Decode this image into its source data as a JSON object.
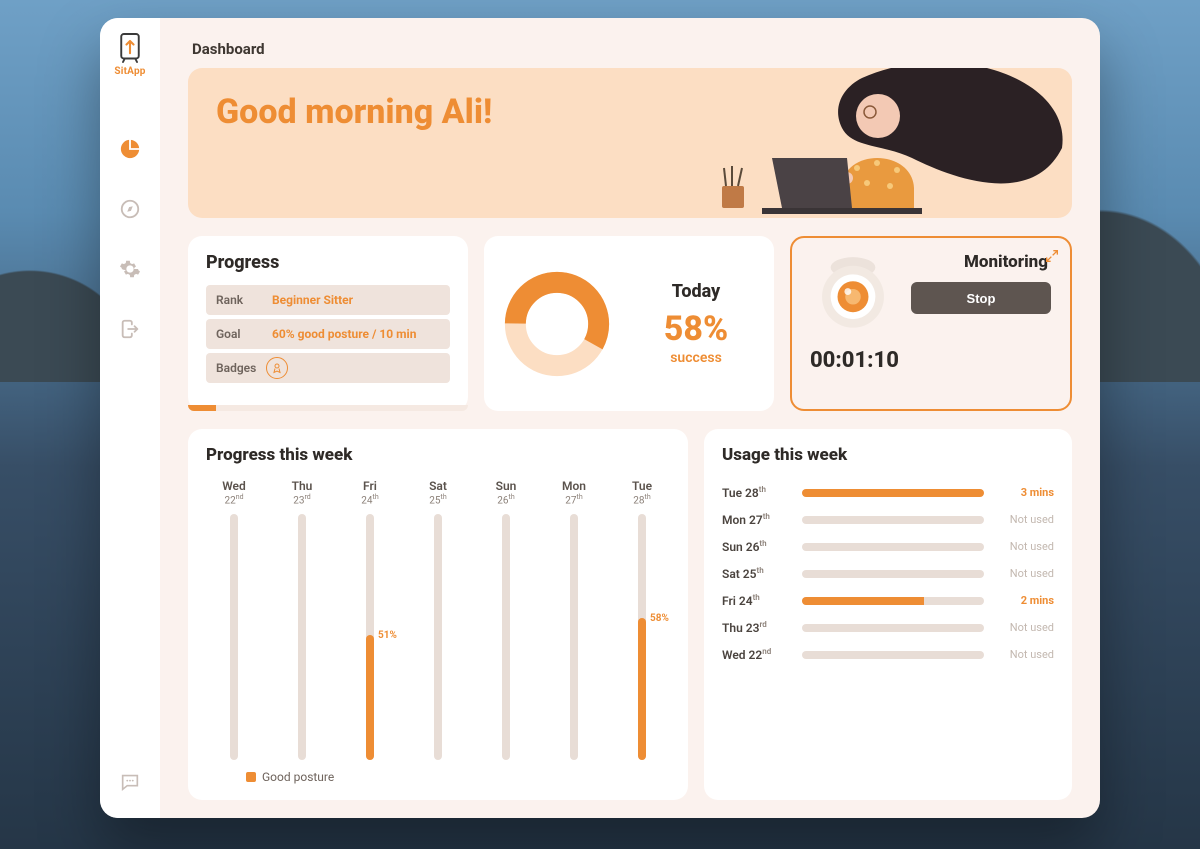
{
  "app": {
    "name": "SitApp"
  },
  "page": {
    "title": "Dashboard"
  },
  "hero": {
    "greeting": "Good morning Ali!"
  },
  "sidebar": {
    "items": [
      {
        "name": "dashboard",
        "active": true
      },
      {
        "name": "explore",
        "active": false
      },
      {
        "name": "settings",
        "active": false
      },
      {
        "name": "logout",
        "active": false
      }
    ],
    "footer_item": {
      "name": "chat"
    }
  },
  "progress_card": {
    "title": "Progress",
    "rank_label": "Rank",
    "rank_value": "Beginner Sitter",
    "goal_label": "Goal",
    "goal_value": "60% good posture / 10 min",
    "badges_label": "Badges",
    "progress_percent": 10
  },
  "today_card": {
    "title": "Today",
    "percent_text": "58%",
    "percent_value": 58,
    "subtitle": "success"
  },
  "monitoring_card": {
    "title": "Monitoring",
    "stop_label": "Stop",
    "timer": "00:01:10"
  },
  "progress_week": {
    "title": "Progress this week",
    "legend": "Good posture",
    "days": [
      {
        "name": "Wed",
        "date": "22",
        "ord": "nd",
        "value": null
      },
      {
        "name": "Thu",
        "date": "23",
        "ord": "rd",
        "value": null
      },
      {
        "name": "Fri",
        "date": "24",
        "ord": "th",
        "value": 51
      },
      {
        "name": "Sat",
        "date": "25",
        "ord": "th",
        "value": null
      },
      {
        "name": "Sun",
        "date": "26",
        "ord": "th",
        "value": null
      },
      {
        "name": "Mon",
        "date": "27",
        "ord": "th",
        "value": null
      },
      {
        "name": "Tue",
        "date": "28",
        "ord": "th",
        "value": 58
      }
    ]
  },
  "usage_week": {
    "title": "Usage this week",
    "max_minutes": 3,
    "days": [
      {
        "label": "Tue 28",
        "ord": "th",
        "minutes": 3,
        "text": "3 mins"
      },
      {
        "label": "Mon 27",
        "ord": "th",
        "minutes": 0,
        "text": "Not used"
      },
      {
        "label": "Sun 26",
        "ord": "th",
        "minutes": 0,
        "text": "Not used"
      },
      {
        "label": "Sat 25",
        "ord": "th",
        "minutes": 0,
        "text": "Not used"
      },
      {
        "label": "Fri 24",
        "ord": "th",
        "minutes": 2,
        "text": "2 mins"
      },
      {
        "label": "Thu 23",
        "ord": "rd",
        "minutes": 0,
        "text": "Not used"
      },
      {
        "label": "Wed 22",
        "ord": "nd",
        "minutes": 0,
        "text": "Not used"
      }
    ]
  },
  "chart_data": [
    {
      "type": "bar",
      "title": "Progress this week",
      "ylabel": "Good posture %",
      "ylim": [
        0,
        100
      ],
      "categories": [
        "Wed 22",
        "Thu 23",
        "Fri 24",
        "Sat 25",
        "Sun 26",
        "Mon 27",
        "Tue 28"
      ],
      "values": [
        null,
        null,
        51,
        null,
        null,
        null,
        58
      ],
      "series_name": "Good posture"
    },
    {
      "type": "bar",
      "title": "Usage this week",
      "xlabel": "minutes",
      "categories": [
        "Tue 28",
        "Mon 27",
        "Sun 26",
        "Sat 25",
        "Fri 24",
        "Thu 23",
        "Wed 22"
      ],
      "values": [
        3,
        0,
        0,
        0,
        2,
        0,
        0
      ]
    },
    {
      "type": "pie",
      "title": "Today",
      "categories": [
        "success",
        "other"
      ],
      "values": [
        58,
        42
      ]
    }
  ],
  "colors": {
    "accent": "#ee8d34",
    "accent_light": "#fcdec3",
    "card_bg": "#ffffff",
    "page_bg": "#fbf2ee",
    "muted": "#c8bdb7",
    "dark": "#5e5550"
  }
}
